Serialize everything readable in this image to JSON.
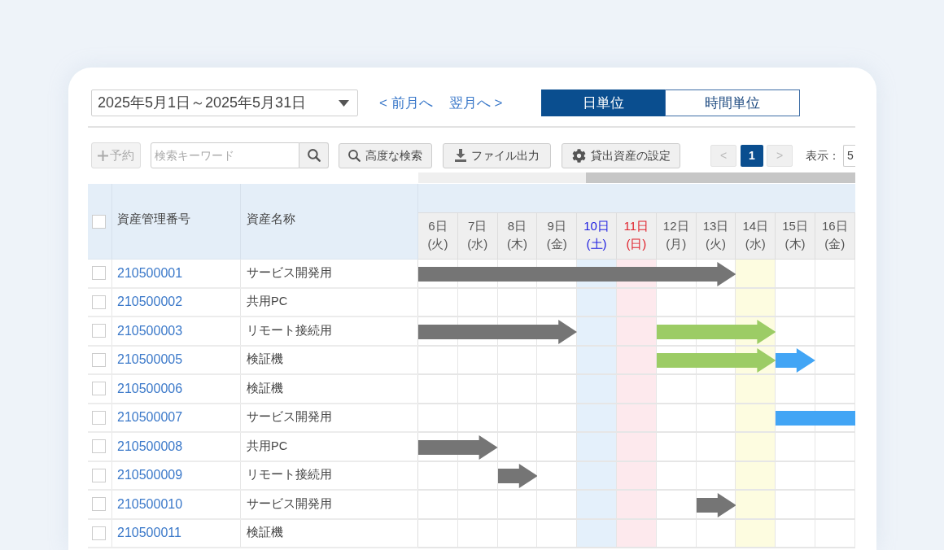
{
  "date_range": {
    "value": "2025年5月1日～2025年5月31日"
  },
  "month_nav": [
    {
      "label": "< 前月へ"
    },
    {
      "label": "翌月へ >"
    }
  ],
  "view_tabs": [
    {
      "label": "日単位",
      "selected": true
    },
    {
      "label": "時間単位",
      "selected": false
    }
  ],
  "toolbar": {
    "add_button": {
      "label": "予約",
      "disabled": true
    },
    "search": {
      "placeholder": "検索キーワード"
    },
    "buttons": [
      {
        "kind": "search",
        "label": "高度な検索"
      },
      {
        "kind": "download",
        "label": "ファイル出力"
      },
      {
        "kind": "settings",
        "label": "貸出資産の設定"
      }
    ]
  },
  "pagination": {
    "prev": {
      "label": "<",
      "disabled": true
    },
    "pages": [
      {
        "label": "1",
        "selected": true
      }
    ],
    "next": {
      "label": ">",
      "disabled": true
    },
    "per_page": {
      "label": "表示：",
      "value": "5"
    }
  },
  "table": {
    "select_all": {
      "checked": false
    },
    "columns": [
      {
        "label": "資産管理番号"
      },
      {
        "label": "資産名称"
      }
    ],
    "days": [
      {
        "day": "6日",
        "weekday": "(火)",
        "kind": "weekday",
        "today": false
      },
      {
        "day": "7日",
        "weekday": "(水)",
        "kind": "weekday",
        "today": false
      },
      {
        "day": "8日",
        "weekday": "(木)",
        "kind": "weekday",
        "today": false
      },
      {
        "day": "9日",
        "weekday": "(金)",
        "kind": "weekday",
        "today": false
      },
      {
        "day": "10日",
        "weekday": "(土)",
        "kind": "saturday",
        "today": false
      },
      {
        "day": "11日",
        "weekday": "(日)",
        "kind": "sunday",
        "today": false
      },
      {
        "day": "12日",
        "weekday": "(月)",
        "kind": "weekday",
        "today": false
      },
      {
        "day": "13日",
        "weekday": "(火)",
        "kind": "weekday",
        "today": false
      },
      {
        "day": "14日",
        "weekday": "(水)",
        "kind": "weekday",
        "today": true
      },
      {
        "day": "15日",
        "weekday": "(木)",
        "kind": "weekday",
        "today": false
      },
      {
        "day": "16日",
        "weekday": "(金)",
        "kind": "weekday",
        "today": false
      }
    ],
    "rows": [
      {
        "checked": false,
        "asset_id": "210500001",
        "name": "サービス開発用",
        "timeline": [
          {
            "kind": "bar",
            "color": "#757575"
          },
          {
            "kind": "bar",
            "color": "#757575"
          },
          {
            "kind": "bar",
            "color": "#757575"
          },
          {
            "kind": "bar",
            "color": "#757575"
          },
          {
            "kind": "bar",
            "color": "#757575"
          },
          {
            "kind": "bar",
            "color": "#757575"
          },
          {
            "kind": "bar",
            "color": "#757575"
          },
          {
            "kind": "head",
            "color": "#757575"
          },
          {
            "kind": "empty"
          },
          {
            "kind": "empty"
          },
          {
            "kind": "empty"
          }
        ]
      },
      {
        "checked": false,
        "asset_id": "210500002",
        "name": "共用PC",
        "timeline": [
          {
            "kind": "empty"
          },
          {
            "kind": "empty"
          },
          {
            "kind": "empty"
          },
          {
            "kind": "empty"
          },
          {
            "kind": "empty"
          },
          {
            "kind": "empty"
          },
          {
            "kind": "empty"
          },
          {
            "kind": "empty"
          },
          {
            "kind": "empty"
          },
          {
            "kind": "empty"
          },
          {
            "kind": "empty"
          }
        ]
      },
      {
        "checked": false,
        "asset_id": "210500003",
        "name": "リモート接続用",
        "timeline": [
          {
            "kind": "bar",
            "color": "#757575"
          },
          {
            "kind": "bar",
            "color": "#757575"
          },
          {
            "kind": "bar",
            "color": "#757575"
          },
          {
            "kind": "head",
            "color": "#757575"
          },
          {
            "kind": "empty"
          },
          {
            "kind": "empty"
          },
          {
            "kind": "bar",
            "color": "#9ccc65"
          },
          {
            "kind": "bar",
            "color": "#9ccc65"
          },
          {
            "kind": "head",
            "color": "#9ccc65"
          },
          {
            "kind": "empty"
          },
          {
            "kind": "empty"
          }
        ]
      },
      {
        "checked": false,
        "asset_id": "210500005",
        "name": "検証機",
        "timeline": [
          {
            "kind": "empty"
          },
          {
            "kind": "empty"
          },
          {
            "kind": "empty"
          },
          {
            "kind": "empty"
          },
          {
            "kind": "empty"
          },
          {
            "kind": "empty"
          },
          {
            "kind": "bar",
            "color": "#9ccc65"
          },
          {
            "kind": "bar",
            "color": "#9ccc65"
          },
          {
            "kind": "head",
            "color": "#9ccc65"
          },
          {
            "kind": "head",
            "color": "#42a5f5"
          },
          {
            "kind": "empty"
          }
        ]
      },
      {
        "checked": false,
        "asset_id": "210500006",
        "name": "検証機",
        "timeline": [
          {
            "kind": "empty"
          },
          {
            "kind": "empty"
          },
          {
            "kind": "empty"
          },
          {
            "kind": "empty"
          },
          {
            "kind": "empty"
          },
          {
            "kind": "empty"
          },
          {
            "kind": "empty"
          },
          {
            "kind": "empty"
          },
          {
            "kind": "empty"
          },
          {
            "kind": "empty"
          },
          {
            "kind": "empty"
          }
        ]
      },
      {
        "checked": false,
        "asset_id": "210500007",
        "name": "サービス開発用",
        "timeline": [
          {
            "kind": "empty"
          },
          {
            "kind": "empty"
          },
          {
            "kind": "empty"
          },
          {
            "kind": "empty"
          },
          {
            "kind": "empty"
          },
          {
            "kind": "empty"
          },
          {
            "kind": "empty"
          },
          {
            "kind": "empty"
          },
          {
            "kind": "empty"
          },
          {
            "kind": "bar",
            "color": "#42a5f5"
          },
          {
            "kind": "bar",
            "color": "#42a5f5"
          }
        ]
      },
      {
        "checked": false,
        "asset_id": "210500008",
        "name": "共用PC",
        "timeline": [
          {
            "kind": "bar",
            "color": "#757575"
          },
          {
            "kind": "head",
            "color": "#757575"
          },
          {
            "kind": "empty"
          },
          {
            "kind": "empty"
          },
          {
            "kind": "empty"
          },
          {
            "kind": "empty"
          },
          {
            "kind": "empty"
          },
          {
            "kind": "empty"
          },
          {
            "kind": "empty"
          },
          {
            "kind": "empty"
          },
          {
            "kind": "empty"
          }
        ]
      },
      {
        "checked": false,
        "asset_id": "210500009",
        "name": "リモート接続用",
        "timeline": [
          {
            "kind": "empty"
          },
          {
            "kind": "empty"
          },
          {
            "kind": "head",
            "color": "#757575"
          },
          {
            "kind": "empty"
          },
          {
            "kind": "empty"
          },
          {
            "kind": "empty"
          },
          {
            "kind": "empty"
          },
          {
            "kind": "empty"
          },
          {
            "kind": "empty"
          },
          {
            "kind": "empty"
          },
          {
            "kind": "empty"
          }
        ]
      },
      {
        "checked": false,
        "asset_id": "210500010",
        "name": "サービス開発用",
        "timeline": [
          {
            "kind": "empty"
          },
          {
            "kind": "empty"
          },
          {
            "kind": "empty"
          },
          {
            "kind": "empty"
          },
          {
            "kind": "empty"
          },
          {
            "kind": "empty"
          },
          {
            "kind": "empty"
          },
          {
            "kind": "head",
            "color": "#757575"
          },
          {
            "kind": "empty"
          },
          {
            "kind": "empty"
          },
          {
            "kind": "empty"
          }
        ]
      },
      {
        "checked": false,
        "asset_id": "210500011",
        "name": "検証機",
        "timeline": [
          {
            "kind": "empty"
          },
          {
            "kind": "empty"
          },
          {
            "kind": "empty"
          },
          {
            "kind": "empty"
          },
          {
            "kind": "empty"
          },
          {
            "kind": "empty"
          },
          {
            "kind": "empty"
          },
          {
            "kind": "empty"
          },
          {
            "kind": "empty"
          },
          {
            "kind": "empty"
          },
          {
            "kind": "empty"
          }
        ]
      }
    ]
  }
}
